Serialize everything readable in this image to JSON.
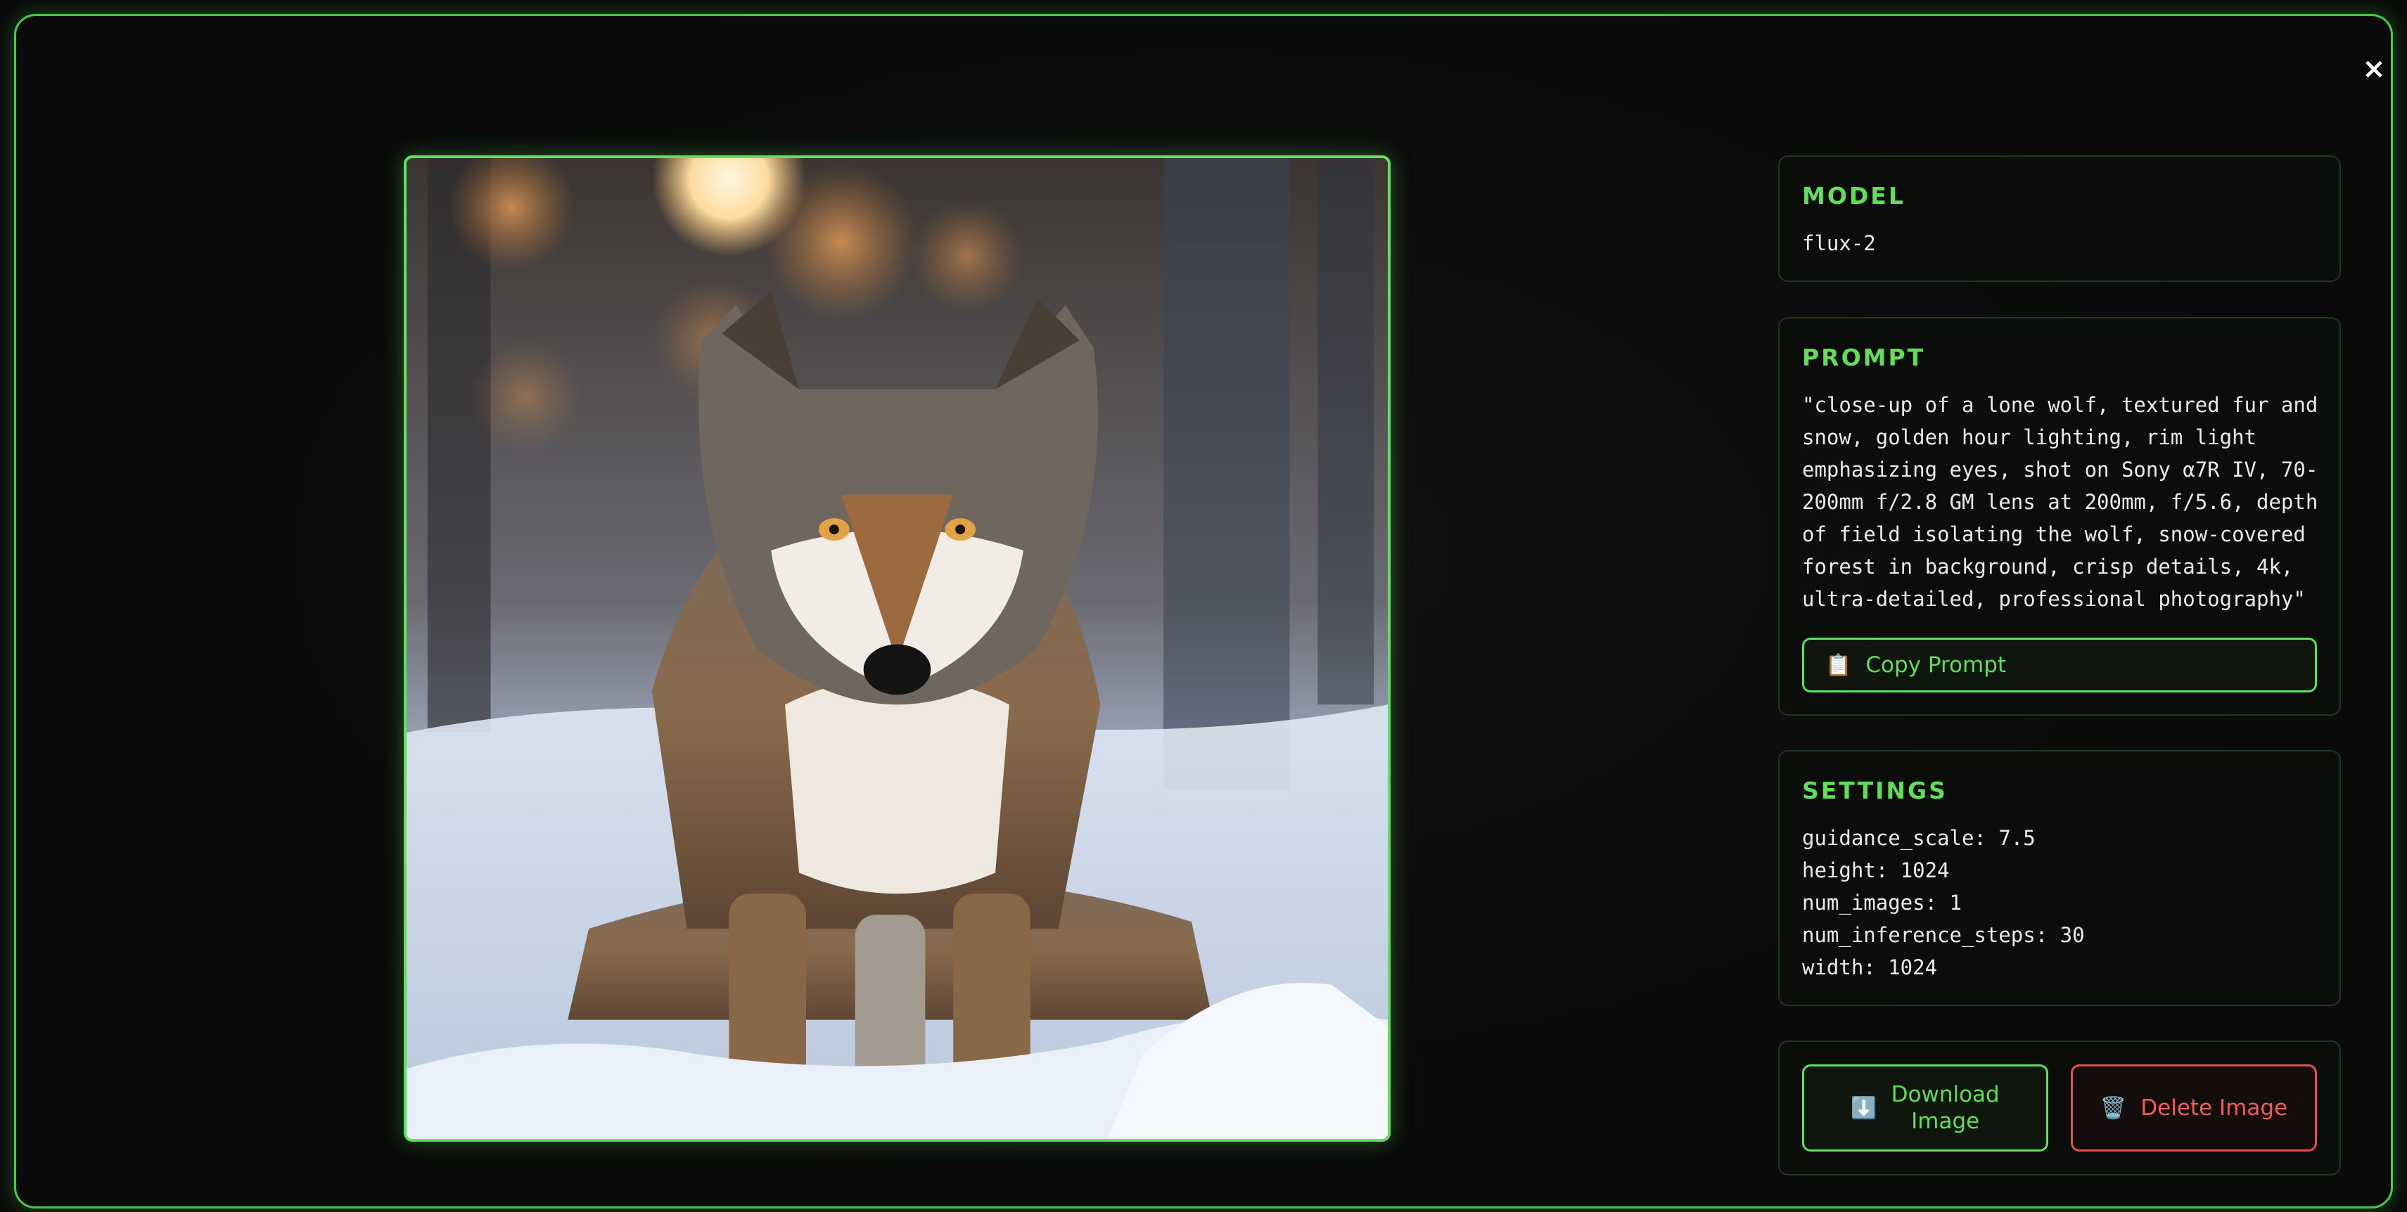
{
  "close_label": "×",
  "image": {
    "alt": "close-up of a lone wolf in snowy forest at golden hour"
  },
  "model": {
    "title": "MODEL",
    "value": "flux-2"
  },
  "prompt": {
    "title": "PROMPT",
    "lines": [
      "\"close-up of a lone wolf, textured fur and",
      "snow, golden hour lighting, rim light",
      "emphasizing eyes, shot on Sony α7R IV, 70-",
      "200mm f/2.8 GM lens at 200mm, f/5.6, depth",
      "of field isolating the wolf, snow-covered",
      "forest in background, crisp details, 4k,",
      "ultra-detailed, professional photography\""
    ],
    "copy_icon": "📋",
    "copy_label": "Copy Prompt"
  },
  "settings": {
    "title": "SETTINGS",
    "lines": [
      "guidance_scale: 7.5",
      "height: 1024",
      "num_images: 1",
      "num_inference_steps: 30",
      "width: 1024"
    ]
  },
  "actions": {
    "download_icon": "⬇️",
    "download_line1": "Download",
    "download_line2": "Image",
    "delete_icon": "🗑️",
    "delete_label": "Delete Image"
  },
  "colors": {
    "accent": "#5fe05f",
    "danger": "#e0534f",
    "background": "#0a0b0a"
  }
}
